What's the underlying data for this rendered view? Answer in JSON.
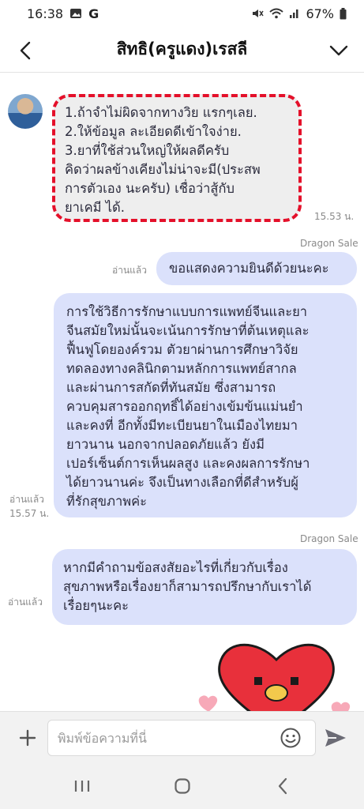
{
  "status_bar": {
    "time": "16:38",
    "carrier_icon": "G",
    "battery": "67%"
  },
  "header": {
    "title": "สิทธิ(ครูแดง)เรสลี",
    "back_icon": "chevron-left-icon",
    "menu_icon": "chevron-down-icon"
  },
  "messages": {
    "incoming": {
      "lines": [
        "1.ถ้าจำไม่ผิดจากทางวิย แรกๆเลย.",
        "2.ให้ข้อมูล ละเอียดดีเข้าใจง่าย.",
        "3.ยาที่ใช้ส่วนใหญ่ให้ผลดีครับ",
        "คิดว่าผลข้างเคียงไม่น่าจะมี(ประสพ",
        "การตัวเอง นะครับ) เชื่อว่าสู้กับ",
        "ยาเคมี ได้."
      ],
      "time": "15.53 น."
    },
    "out1": {
      "sender": "Dragon Sale",
      "read": "อ่านแล้ว",
      "text": "ขอแสดงความยินดีด้วยนะคะ"
    },
    "out2": {
      "lines": [
        "การใช้วิธีการรักษาแบบการแพทย์จีนและยา",
        "จีนสมัยใหม่นั้นจะเน้นการรักษาที่ต้นเหตุและ",
        "ฟื้นฟูโดยองค์รวม ตัวยาผ่านการศึกษาวิจัย",
        "ทดลองทางคลินิกตามหลักการแพทย์สากล",
        "และผ่านการสกัดที่ทันสมัย ซึ่งสามารถ",
        "ควบคุมสารออกฤทธิ์ได้อย่างเข้มข้นแม่นยำ",
        "และคงที่ อีกทั้งมีทะเบียนยาในเมืองไทยมา",
        "ยาวนาน นอกจากปลอดภัยแล้ว ยังมี",
        "เปอร์เซ็นต์การเห็นผลสูง และคงผลการรักษา",
        "ได้ยาวนานค่ะ จึงเป็นทางเลือกที่ดีสำหรับผู้",
        "ที่รักสุขภาพค่ะ"
      ],
      "read": "อ่านแล้ว",
      "time": "15.57 น."
    },
    "out3": {
      "sender": "Dragon Sale",
      "read": "อ่านแล้ว",
      "lines": [
        "หากมีคำถามข้อสงสัยอะไรที่เกี่ยวกับเรื่อง",
        "สุขภาพหรือเรื่องยาก็สามารถปรึกษากับเราได้",
        "เรื่อยๆนะคะ"
      ]
    }
  },
  "input": {
    "placeholder": "พิมพ์ข้อความที่นี่"
  },
  "colors": {
    "outgoing_bubble": "#dbe1fb",
    "incoming_bubble": "#eeeeee",
    "highlight_outline": "#e4102a"
  }
}
